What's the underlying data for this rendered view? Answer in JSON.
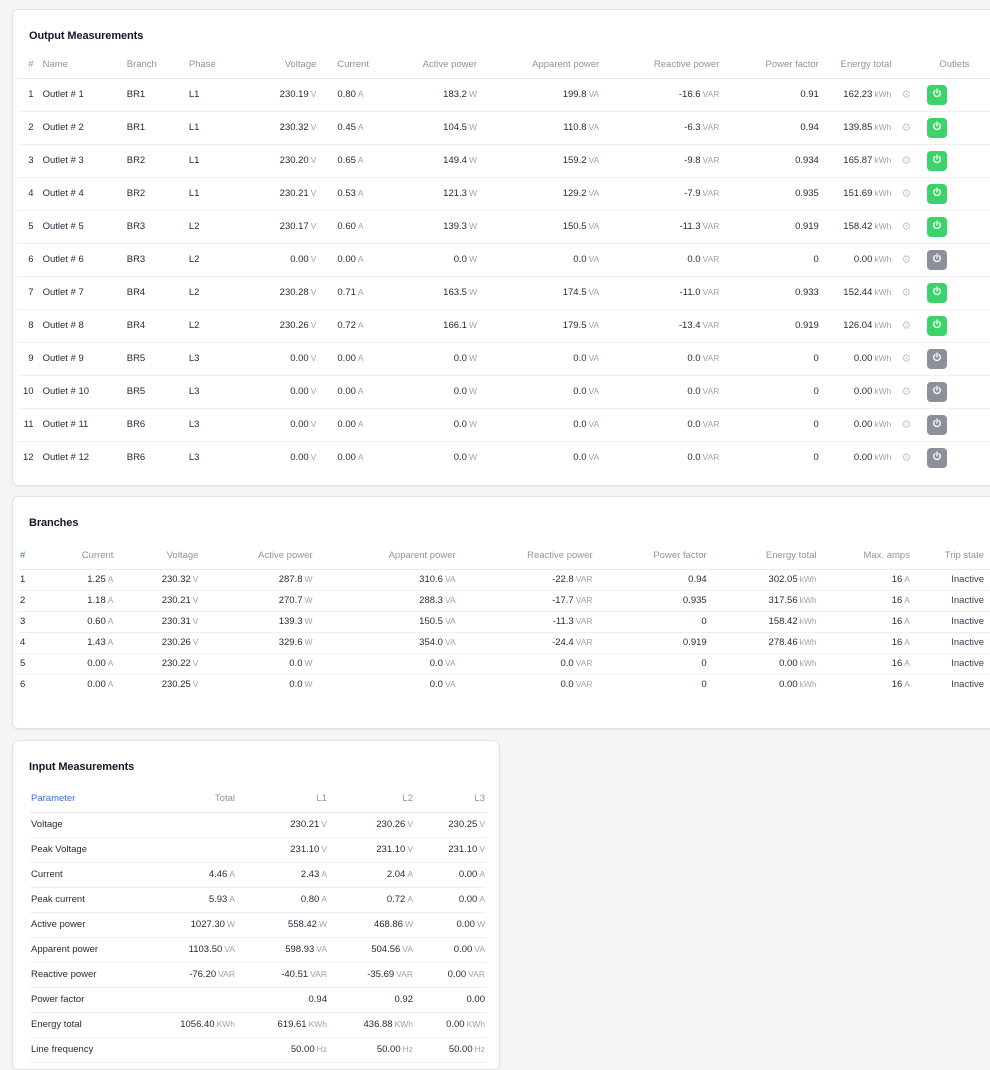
{
  "output": {
    "title": "Output Measurements",
    "headers": [
      "#",
      "Name",
      "Branch",
      "Phase",
      "Voltage",
      "Current",
      "Active power",
      "Apparent power",
      "Reactive power",
      "Power factor",
      "Energy total",
      "Outlets"
    ],
    "rows": [
      {
        "n": "1",
        "name": "Outlet # 1",
        "branch": "BR1",
        "phase": "L1",
        "voltage": "230.19",
        "current": "0.80",
        "active": "183.2",
        "apparent": "199.8",
        "reactive": "-16.6",
        "pf": "0.91",
        "energy": "162.23",
        "on": true
      },
      {
        "n": "2",
        "name": "Outlet # 2",
        "branch": "BR1",
        "phase": "L1",
        "voltage": "230.32",
        "current": "0.45",
        "active": "104.5",
        "apparent": "110.8",
        "reactive": "-6.3",
        "pf": "0.94",
        "energy": "139.85",
        "on": true
      },
      {
        "n": "3",
        "name": "Outlet # 3",
        "branch": "BR2",
        "phase": "L1",
        "voltage": "230.20",
        "current": "0.65",
        "active": "149.4",
        "apparent": "159.2",
        "reactive": "-9.8",
        "pf": "0.934",
        "energy": "165.87",
        "on": true
      },
      {
        "n": "4",
        "name": "Outlet # 4",
        "branch": "BR2",
        "phase": "L1",
        "voltage": "230.21",
        "current": "0.53",
        "active": "121.3",
        "apparent": "129.2",
        "reactive": "-7.9",
        "pf": "0.935",
        "energy": "151.69",
        "on": true
      },
      {
        "n": "5",
        "name": "Outlet # 5",
        "branch": "BR3",
        "phase": "L2",
        "voltage": "230.17",
        "current": "0.60",
        "active": "139.3",
        "apparent": "150.5",
        "reactive": "-11.3",
        "pf": "0.919",
        "energy": "158.42",
        "on": true
      },
      {
        "n": "6",
        "name": "Outlet # 6",
        "branch": "BR3",
        "phase": "L2",
        "voltage": "0.00",
        "current": "0.00",
        "active": "0.0",
        "apparent": "0.0",
        "reactive": "0.0",
        "pf": "0",
        "energy": "0.00",
        "on": false
      },
      {
        "n": "7",
        "name": "Outlet # 7",
        "branch": "BR4",
        "phase": "L2",
        "voltage": "230.28",
        "current": "0.71",
        "active": "163.5",
        "apparent": "174.5",
        "reactive": "-11.0",
        "pf": "0.933",
        "energy": "152.44",
        "on": true
      },
      {
        "n": "8",
        "name": "Outlet # 8",
        "branch": "BR4",
        "phase": "L2",
        "voltage": "230.26",
        "current": "0.72",
        "active": "166.1",
        "apparent": "179.5",
        "reactive": "-13.4",
        "pf": "0.919",
        "energy": "126.04",
        "on": true
      },
      {
        "n": "9",
        "name": "Outlet # 9",
        "branch": "BR5",
        "phase": "L3",
        "voltage": "0.00",
        "current": "0.00",
        "active": "0.0",
        "apparent": "0.0",
        "reactive": "0.0",
        "pf": "0",
        "energy": "0.00",
        "on": false
      },
      {
        "n": "10",
        "name": "Outlet # 10",
        "branch": "BR5",
        "phase": "L3",
        "voltage": "0.00",
        "current": "0.00",
        "active": "0.0",
        "apparent": "0.0",
        "reactive": "0.0",
        "pf": "0",
        "energy": "0.00",
        "on": false
      },
      {
        "n": "11",
        "name": "Outlet # 11",
        "branch": "BR6",
        "phase": "L3",
        "voltage": "0.00",
        "current": "0.00",
        "active": "0.0",
        "apparent": "0.0",
        "reactive": "0.0",
        "pf": "0",
        "energy": "0.00",
        "on": false
      },
      {
        "n": "12",
        "name": "Outlet # 12",
        "branch": "BR6",
        "phase": "L3",
        "voltage": "0.00",
        "current": "0.00",
        "active": "0.0",
        "apparent": "0.0",
        "reactive": "0.0",
        "pf": "0",
        "energy": "0.00",
        "on": false
      }
    ]
  },
  "branches": {
    "title": "Branches",
    "headers": [
      "#",
      "Current",
      "Voltage",
      "Active power",
      "Apparent power",
      "Reactive power",
      "Power factor",
      "Energy total",
      "Max. amps",
      "Trip state"
    ],
    "rows": [
      {
        "n": "1",
        "current": "1.25",
        "voltage": "230.32",
        "active": "287.8",
        "apparent": "310.6",
        "reactive": "-22.8",
        "pf": "0.94",
        "energy": "302.05",
        "max": "16",
        "trip": "Inactive"
      },
      {
        "n": "2",
        "current": "1.18",
        "voltage": "230.21",
        "active": "270.7",
        "apparent": "288.3",
        "reactive": "-17.7",
        "pf": "0.935",
        "energy": "317.56",
        "max": "16",
        "trip": "Inactive"
      },
      {
        "n": "3",
        "current": "0.60",
        "voltage": "230.31",
        "active": "139.3",
        "apparent": "150.5",
        "reactive": "-11.3",
        "pf": "0",
        "energy": "158.42",
        "max": "16",
        "trip": "Inactive"
      },
      {
        "n": "4",
        "current": "1.43",
        "voltage": "230.26",
        "active": "329.6",
        "apparent": "354.0",
        "reactive": "-24.4",
        "pf": "0.919",
        "energy": "278.46",
        "max": "16",
        "trip": "Inactive"
      },
      {
        "n": "5",
        "current": "0.00",
        "voltage": "230.22",
        "active": "0.0",
        "apparent": "0.0",
        "reactive": "0.0",
        "pf": "0",
        "energy": "0.00",
        "max": "16",
        "trip": "Inactive"
      },
      {
        "n": "6",
        "current": "0.00",
        "voltage": "230.25",
        "active": "0.0",
        "apparent": "0.0",
        "reactive": "0.0",
        "pf": "0",
        "energy": "0.00",
        "max": "16",
        "trip": "Inactive"
      }
    ]
  },
  "input": {
    "title": "Input Measurements",
    "headers": [
      "Parameter",
      "Total",
      "L1",
      "L2",
      "L3"
    ],
    "rows": [
      {
        "param": "Voltage",
        "unit": "V",
        "total": "",
        "l1": "230.21",
        "l2": "230.26",
        "l3": "230.25"
      },
      {
        "param": "Peak Voltage",
        "unit": "V",
        "total": "",
        "l1": "231.10",
        "l2": "231.10",
        "l3": "231.10"
      },
      {
        "param": "Current",
        "unit": "A",
        "total": "4.46",
        "l1": "2.43",
        "l2": "2.04",
        "l3": "0.00"
      },
      {
        "param": "Peak current",
        "unit": "A",
        "total": "5.93",
        "l1": "0.80",
        "l2": "0.72",
        "l3": "0.00"
      },
      {
        "param": "Active power",
        "unit": "W",
        "total": "1027.30",
        "l1": "558.42",
        "l2": "468.86",
        "l3": "0.00"
      },
      {
        "param": "Apparent power",
        "unit": "VA",
        "total": "1103.50",
        "l1": "598.93",
        "l2": "504.56",
        "l3": "0.00"
      },
      {
        "param": "Reactive power",
        "unit": "VAR",
        "total": "-76.20",
        "l1": "-40.51",
        "l2": "-35.69",
        "l3": "0.00"
      },
      {
        "param": "Power factor",
        "unit": "",
        "total": "",
        "l1": "0.94",
        "l2": "0.92",
        "l3": "0.00"
      },
      {
        "param": "Energy total",
        "unit": "KWh",
        "total": "1056.40",
        "l1": "619.61",
        "l2": "436.88",
        "l3": "0.00"
      },
      {
        "param": "Line frequency",
        "unit": "Hz",
        "total": "",
        "l1": "50.00",
        "l2": "50.00",
        "l3": "50.00"
      }
    ]
  },
  "units": {
    "voltage": "V",
    "current": "A",
    "active": "W",
    "apparent": "VA",
    "reactive": "VAR",
    "energy": "kWh"
  },
  "icons": {
    "settings": "gear-icon",
    "power": "power-icon"
  },
  "colors": {
    "on": "#3dd36b",
    "off": "#8b9099",
    "link": "#3b6fd8"
  }
}
